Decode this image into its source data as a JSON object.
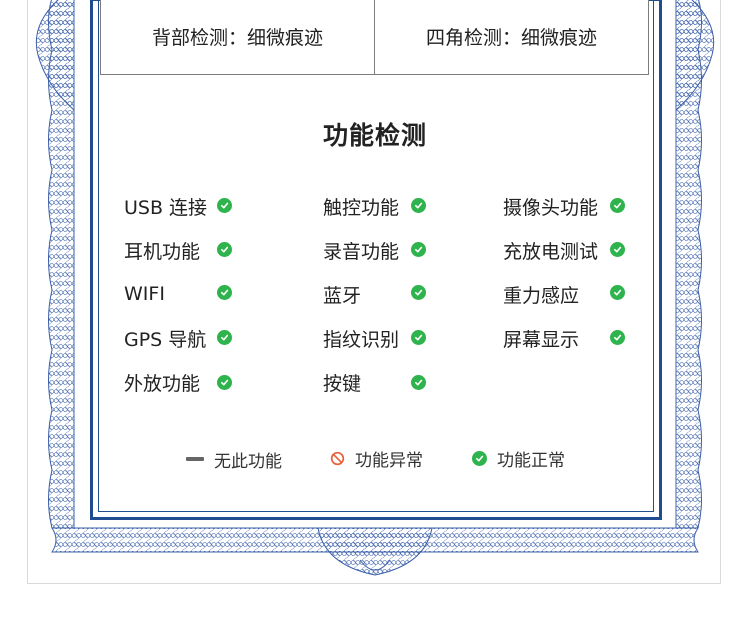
{
  "top_table": {
    "back": "背部检测：细微痕迹",
    "corners": "四角检测：细微痕迹"
  },
  "section_title": "功能检测",
  "features": {
    "usb": "USB 连接",
    "touch": "触控功能",
    "camera": "摄像头功能",
    "earphone": "耳机功能",
    "recording": "录音功能",
    "charging": "充放电测试",
    "wifi": "WIFI",
    "bluetooth": "蓝牙",
    "gravity": "重力感应",
    "gps": "GPS 导航",
    "fingerprint": "指纹识别",
    "display": "屏幕显示",
    "speaker": "外放功能",
    "buttons": "按键"
  },
  "legend": {
    "none": "无此功能",
    "abnormal": "功能异常",
    "normal": "功能正常"
  },
  "colors": {
    "frame_blue": "#1f4d8f",
    "ok_green": "#2fb34d",
    "abnormal_orange": "#e8613c"
  }
}
